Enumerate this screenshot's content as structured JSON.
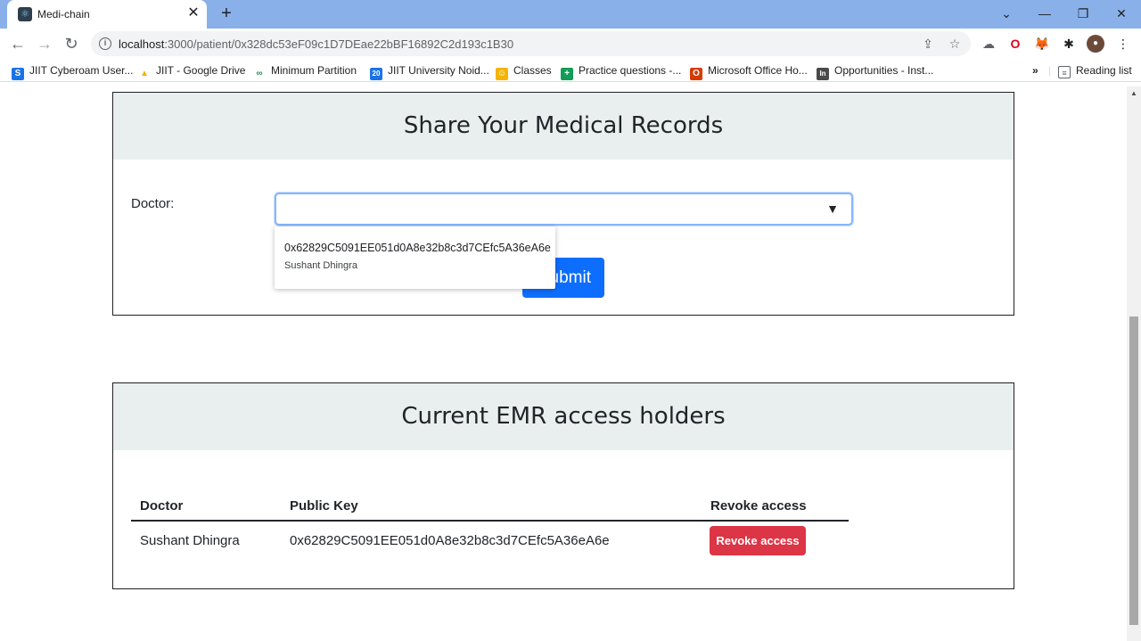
{
  "browser": {
    "tab_title": "Medi-chain",
    "url_host": "localhost",
    "url_path": ":3000/patient/0x328dc53eF09c1D7DEae22bBF16892C2d193c1B30",
    "bookmarks": [
      {
        "label": "JIIT Cyberoam User...",
        "icon": "S",
        "color": "#1a73e8"
      },
      {
        "label": "JIIT - Google Drive",
        "icon": "▲",
        "color": "#f4b400"
      },
      {
        "label": "Minimum Partition",
        "icon": "∞",
        "color": "#2e8b57"
      },
      {
        "label": "JIIT University Noid...",
        "icon": "20",
        "color": "#1a73e8"
      },
      {
        "label": "Classes",
        "icon": "☺",
        "color": "#f4b400"
      },
      {
        "label": "Practice questions -...",
        "icon": "+",
        "color": "#0f9d58"
      },
      {
        "label": "Microsoft Office Ho...",
        "icon": "O",
        "color": "#d83b01"
      },
      {
        "label": "Opportunities - Inst...",
        "icon": "In",
        "color": "#4a4a4a"
      }
    ],
    "reading_list": "Reading list"
  },
  "share": {
    "title": "Share Your Medical Records",
    "doctor_label": "Doctor:",
    "submit_label": "Submit",
    "dropdown_option": {
      "key": "0x62829C5091EE051d0A8e32b8c3d7CEfc5A36eA6e",
      "name": "Sushant Dhingra"
    }
  },
  "holders": {
    "title": "Current EMR access holders",
    "columns": [
      "Doctor",
      "Public Key",
      "Revoke access"
    ],
    "rows": [
      {
        "doctor": "Sushant Dhingra",
        "public_key": "0x62829C5091EE051d0A8e32b8c3d7CEfc5A36eA6e",
        "action": "Revoke access"
      }
    ]
  },
  "colors": {
    "primary": "#0d6efd",
    "danger": "#dc3545",
    "header_bg": "#e9eeee"
  }
}
